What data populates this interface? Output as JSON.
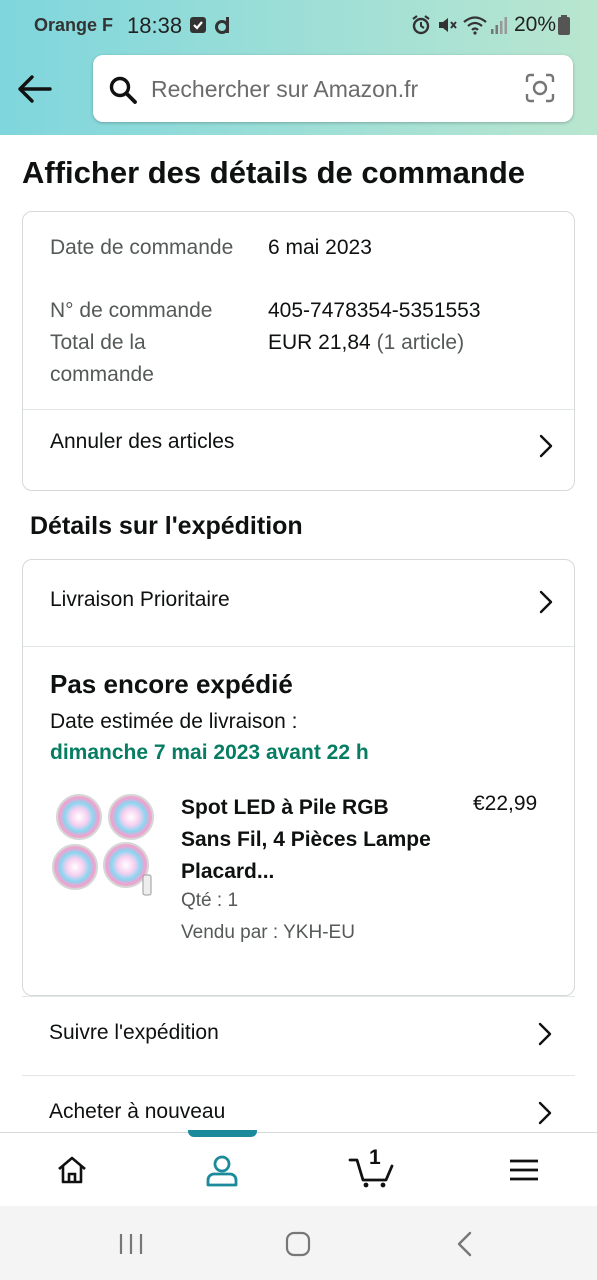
{
  "status_bar": {
    "carrier": "Orange F",
    "time": "18:38",
    "battery": "20%"
  },
  "search": {
    "placeholder": "Rechercher sur Amazon.fr"
  },
  "page_title": "Afficher des détails de commande",
  "order": {
    "date_label": "Date de commande",
    "date_value": "6 mai 2023",
    "number_label": "N° de commande",
    "number_value": "405-7478354-5351553",
    "total_label": "Total de la commande",
    "total_value": "EUR 21,84",
    "total_items": "(1 article)",
    "cancel_label": "Annuler des articles"
  },
  "shipping": {
    "section_title": "Détails sur l'expédition",
    "delivery_option": "Livraison Prioritaire",
    "status": "Pas encore expédié",
    "estimate_label": "Date estimée de livraison :",
    "estimate_date": "dimanche 7 mai 2023 avant 22 h",
    "product": {
      "title": "Spot LED à Pile RGB Sans Fil, 4 Pièces Lampe Placard...",
      "price": "€22,99",
      "quantity": "Qté : 1",
      "seller": "Vendu par : YKH-EU"
    }
  },
  "actions": {
    "track": "Suivre l'expédition",
    "buy_again": "Acheter à nouveau"
  },
  "bottom_nav": {
    "cart_count": "1",
    "active_tab": "account"
  },
  "colors": {
    "header_gradient_start": "#7fd6dd",
    "header_gradient_end": "#b9e6cf",
    "accent": "#1b8a9a",
    "delivery_green": "#067d62"
  },
  "icons": {
    "back": "arrow-left-icon",
    "search": "search-icon",
    "camera": "camera-scan-icon",
    "home": "home-icon",
    "account": "person-icon",
    "cart": "cart-icon",
    "menu": "hamburger-menu-icon"
  }
}
